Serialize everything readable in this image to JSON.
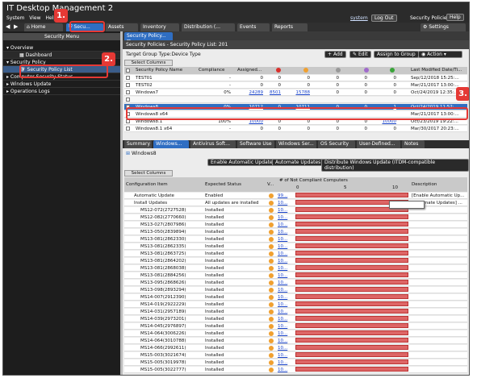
{
  "app": {
    "title": "IT Desktop Management 2"
  },
  "menu": {
    "items": [
      "System",
      "View",
      "Help"
    ]
  },
  "top_right": {
    "user": "system",
    "logout": "Log Out",
    "context": "Security Policies",
    "help": "Help"
  },
  "tabs": [
    {
      "label": "Home"
    },
    {
      "label": "Secu..."
    },
    {
      "label": "Assets"
    },
    {
      "label": "Inventory"
    },
    {
      "label": "Distribution (..."
    },
    {
      "label": "Events"
    },
    {
      "label": "Reports"
    },
    {
      "label": "Settings"
    }
  ],
  "sidebar": {
    "header": "Security Menu",
    "items": [
      {
        "label": "Overview"
      },
      {
        "label": "Dashboard"
      },
      {
        "label": "Security Policy"
      },
      {
        "label": "Security Policy List"
      },
      {
        "label": "Computer Security Status"
      },
      {
        "label": "Windows Update"
      },
      {
        "label": "Operations Logs"
      }
    ]
  },
  "main": {
    "tab_label": "Security Policy...",
    "heading": "Security Policies - Security Policy List: 201",
    "target_group": "Target Group Type:Device Type",
    "buttons": {
      "add": "Add",
      "edit": "Edit",
      "assign": "Assign to Group",
      "action": "Action"
    },
    "select_columns": "Select Columns",
    "columns": [
      "Security Policy Name",
      "Compliance",
      "Assigned...",
      "",
      "",
      "",
      "",
      "",
      "Last Modified Date/Ti..."
    ],
    "rows": [
      {
        "name": "TEST01",
        "compliance": "-",
        "assigned": "0",
        "c1": "0",
        "c2": "0",
        "c3": "0",
        "c4": "0",
        "c5": "0",
        "date": "Sep/12/2018 15:25:..."
      },
      {
        "name": "TEST02",
        "compliance": "-",
        "assigned": "0",
        "c1": "0",
        "c2": "0",
        "c3": "0",
        "c4": "0",
        "c5": "0",
        "date": "Mar/21/2017 13:00:..."
      },
      {
        "name": "Windows7",
        "compliance": "0%",
        "assigned": "24289",
        "c1": "8501",
        "c2": "15788",
        "c3": "0",
        "c4": "0",
        "c5": "0",
        "date": "Oct/24/2019 12:35:..."
      },
      {
        "name": "",
        "compliance": "",
        "assigned": "",
        "c1": "",
        "c2": "",
        "c3": "",
        "c4": "",
        "c5": "",
        "date": ""
      },
      {
        "name": "Windows8",
        "compliance": "0%",
        "assigned": "10712",
        "c1": "0",
        "c2": "10711",
        "c3": "0",
        "c4": "0",
        "c5": "1",
        "date": "Oct/24/2019 11:52:..."
      },
      {
        "name": "Windows8 x64",
        "compliance": "",
        "assigned": "",
        "c1": "",
        "c2": "",
        "c3": "",
        "c4": "",
        "c5": "",
        "date": "Mar/21/2017 13:00:..."
      },
      {
        "name": "Windows8.1",
        "compliance": "100%",
        "assigned": "10000",
        "c1": "0",
        "c2": "0",
        "c3": "0",
        "c4": "0",
        "c5": "10000",
        "date": "Oct/23/2019 19:22:..."
      },
      {
        "name": "Windows8.1 x64",
        "compliance": "-",
        "assigned": "0",
        "c1": "0",
        "c2": "0",
        "c3": "0",
        "c4": "0",
        "c5": "0",
        "date": "Mar/30/2017 20:23:..."
      }
    ],
    "subtabs": [
      "Summary",
      "Windows...",
      "Antivirus Soft...",
      "Software Use",
      "Windows Ser...",
      "OS Security",
      "User-Defined...",
      "Notes"
    ],
    "detail_title": "Windows8",
    "detail_buttons": {
      "auto_update": "Enable Automatic Update",
      "auto_updates": "Automate Updates",
      "distribute": "Distribute Windows Update (ITDM-compatible distribution)"
    },
    "detail_select_columns": "Select Columns",
    "detail_columns": {
      "item": "Configuration Item",
      "expected": "Expected Status",
      "v": "V...",
      "count_header": "# of Not Compliant Computers",
      "tick0": "0",
      "tick5": "5",
      "tick10": "10",
      "desc": "Description"
    },
    "tooltip": "Description",
    "detail_rows": [
      {
        "item": "Automatic Update",
        "expected": "Enabled",
        "num": "99...",
        "desc": "[Enable Automatic Up..."
      },
      {
        "item": "Install Updates",
        "expected": "All updates are installed",
        "num": "10...",
        "desc": "[Automate Updates] ..."
      },
      {
        "item": "MS12-072(2727528)",
        "expected": "Installed",
        "num": "10..."
      },
      {
        "item": "MS12-082(2770660)",
        "expected": "Installed",
        "num": "10..."
      },
      {
        "item": "MS13-027(2807986)",
        "expected": "Installed",
        "num": "10..."
      },
      {
        "item": "MS13-050(2839894)",
        "expected": "Installed",
        "num": "10..."
      },
      {
        "item": "MS13-081(2862330)",
        "expected": "Installed",
        "num": "10..."
      },
      {
        "item": "MS13-081(2862335)",
        "expected": "Installed",
        "num": "10..."
      },
      {
        "item": "MS13-081(2863725)",
        "expected": "Installed",
        "num": "10..."
      },
      {
        "item": "MS13-081(2864202)",
        "expected": "Installed",
        "num": "10..."
      },
      {
        "item": "MS13-081(2868038)",
        "expected": "Installed",
        "num": "10..."
      },
      {
        "item": "MS13-081(2884256)",
        "expected": "Installed",
        "num": "10..."
      },
      {
        "item": "MS13-095(2868626)",
        "expected": "Installed",
        "num": "10..."
      },
      {
        "item": "MS13-098(2893294)",
        "expected": "Installed",
        "num": "10..."
      },
      {
        "item": "MS14-007(2912390)",
        "expected": "Installed",
        "num": "10..."
      },
      {
        "item": "MS14-019(2922229)",
        "expected": "Installed",
        "num": "10..."
      },
      {
        "item": "MS14-031(2957189)",
        "expected": "Installed",
        "num": "10..."
      },
      {
        "item": "MS14-039(2973201)",
        "expected": "Installed",
        "num": "10..."
      },
      {
        "item": "MS14-045(2976897)",
        "expected": "Installed",
        "num": "10..."
      },
      {
        "item": "MS14-064(3006226)",
        "expected": "Installed",
        "num": "10..."
      },
      {
        "item": "MS14-064(3010788)",
        "expected": "Installed",
        "num": "10..."
      },
      {
        "item": "MS14-066(2992611)",
        "expected": "Installed",
        "num": "10..."
      },
      {
        "item": "MS15-003(3021674)",
        "expected": "Installed",
        "num": "10..."
      },
      {
        "item": "MS15-005(3019978)",
        "expected": "Installed",
        "num": "10..."
      },
      {
        "item": "MS15-005(3022777)",
        "expected": "Installed",
        "num": "10..."
      }
    ]
  },
  "callouts": [
    "1.",
    "2.",
    "3."
  ],
  "colors": {
    "accent": "#2f6ec2",
    "callout": "#e53935",
    "bar": "#dd6666"
  }
}
